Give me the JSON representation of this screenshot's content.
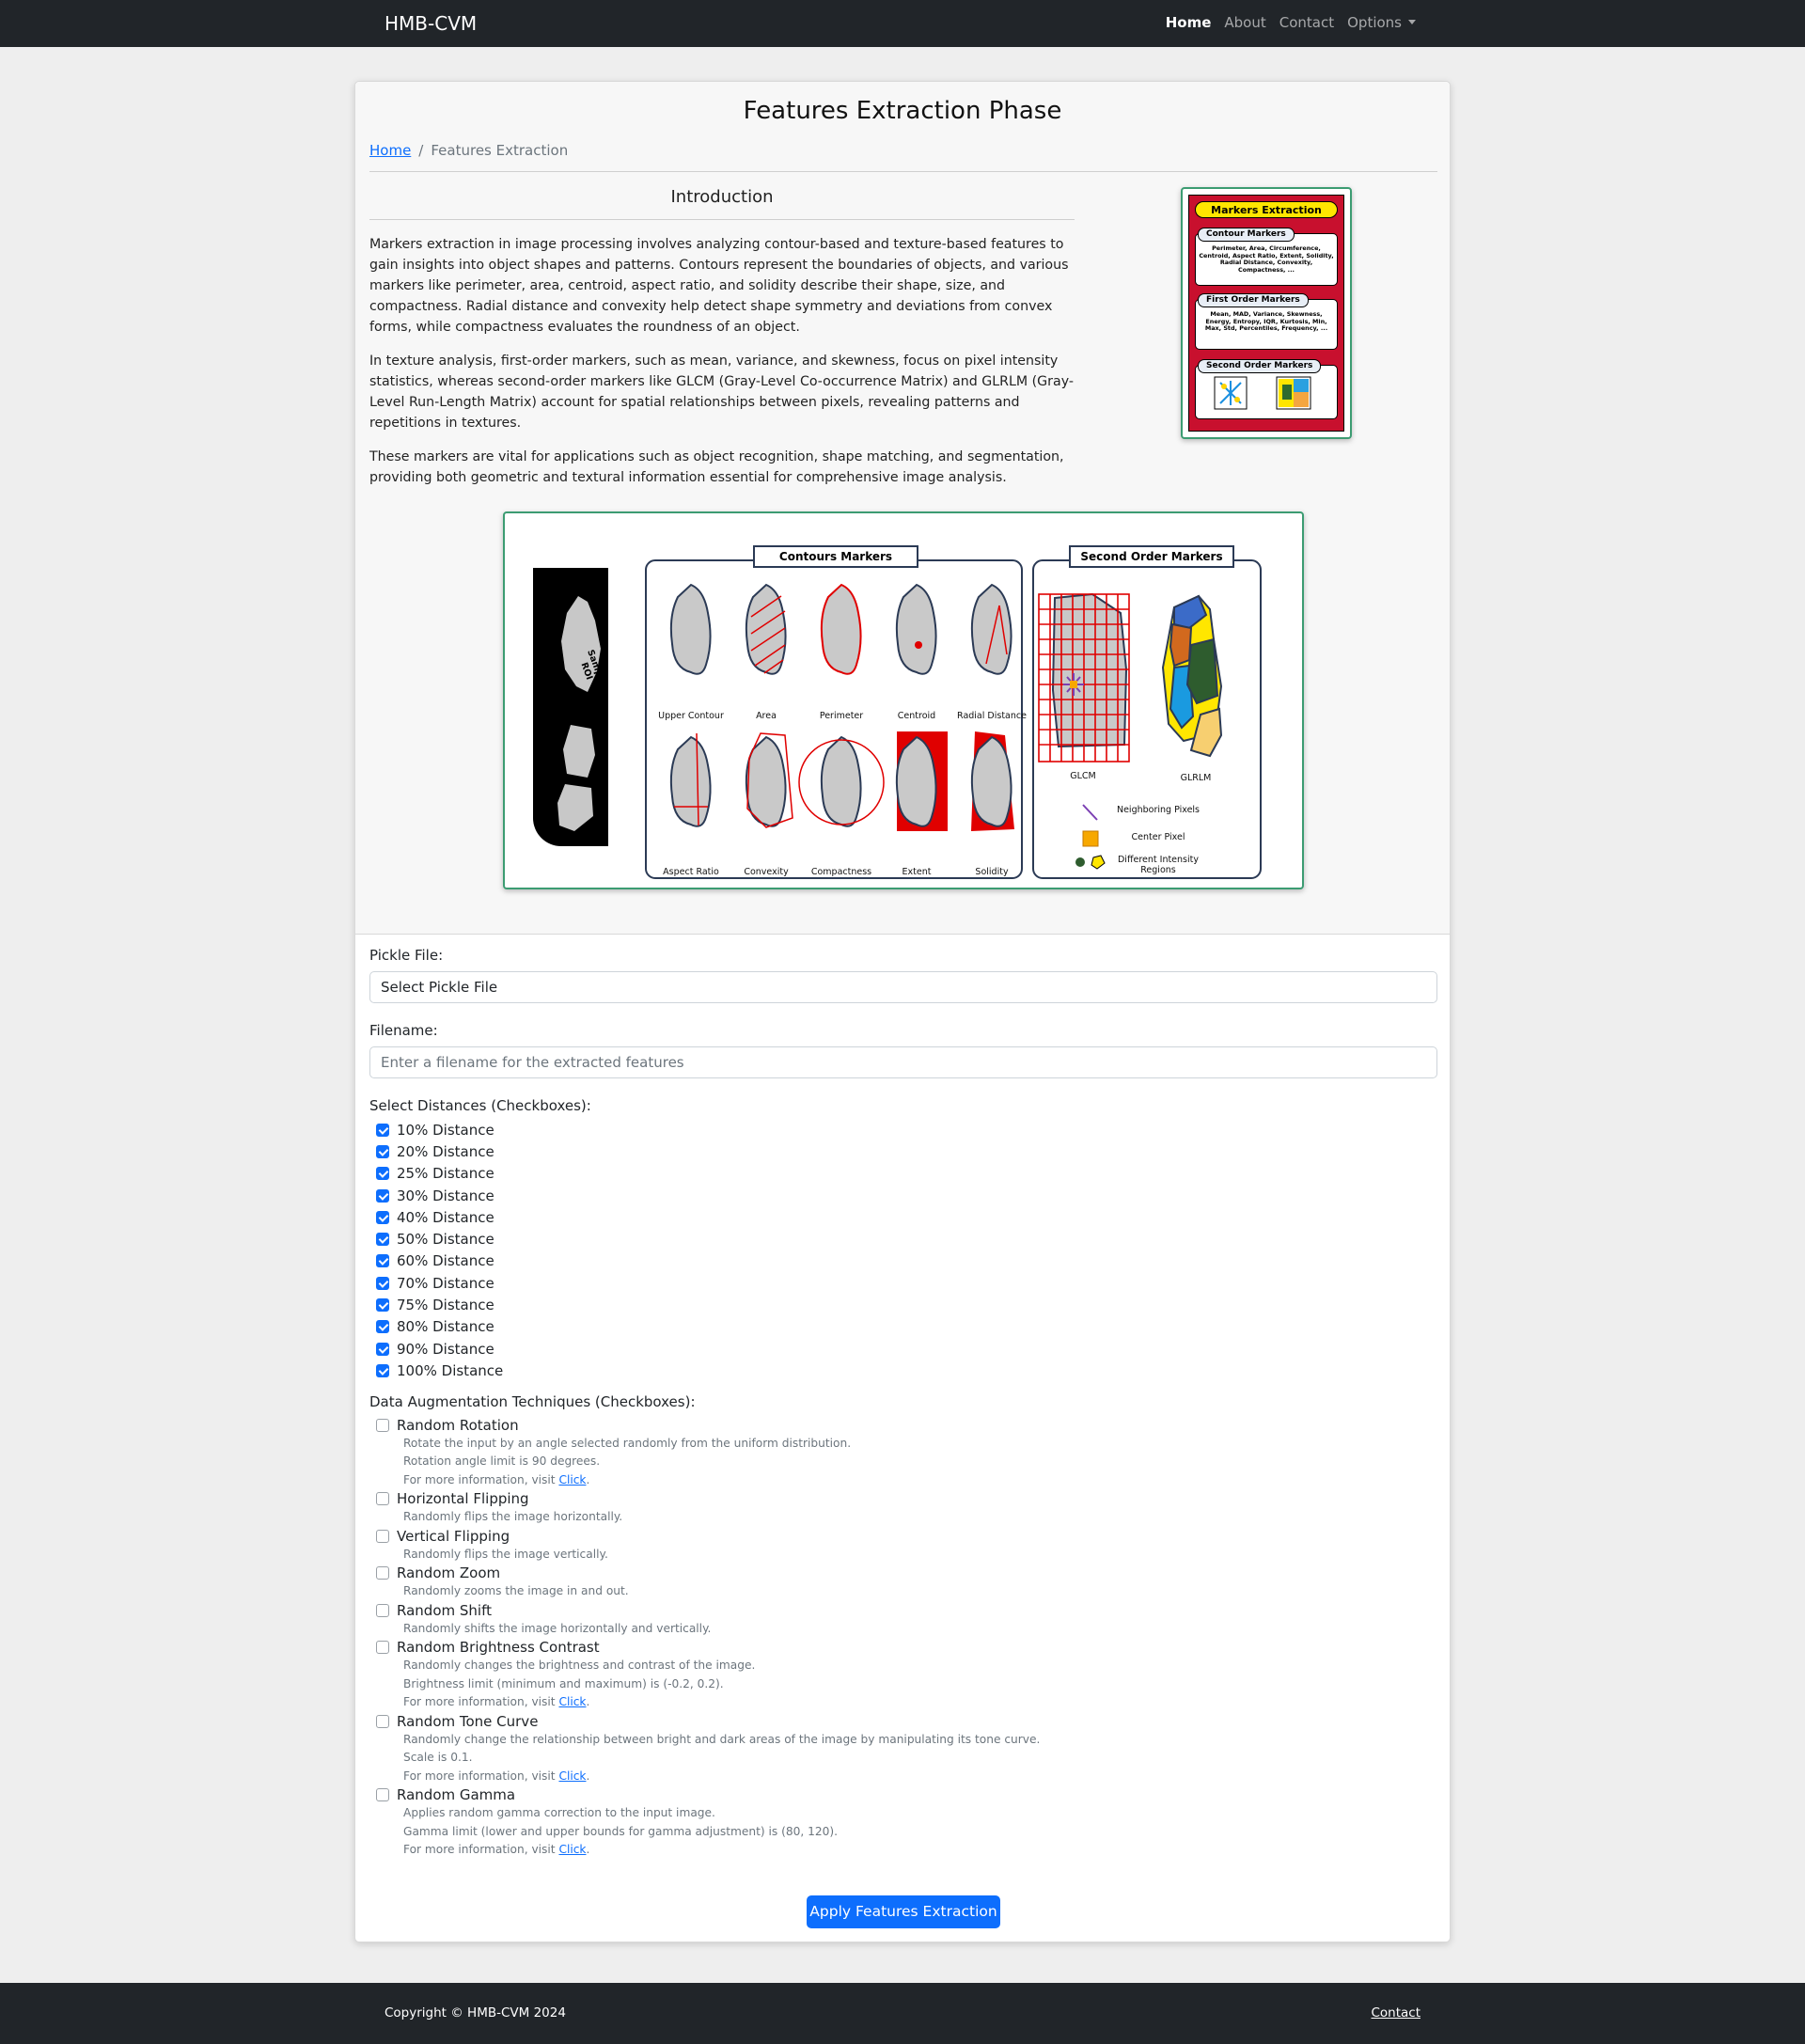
{
  "navbar": {
    "brand": "HMB-CVM",
    "links": [
      "Home",
      "About",
      "Contact",
      "Options"
    ]
  },
  "page": {
    "title": "Features Extraction Phase",
    "breadcrumb": [
      "Home",
      "Features Extraction"
    ]
  },
  "intro": {
    "heading": "Introduction",
    "paragraphs": [
      "Markers extraction in image processing involves analyzing contour-based and texture-based features to gain insights into object shapes and patterns. Contours represent the boundaries of objects, and various markers like perimeter, area, centroid, aspect ratio, and solidity describe their shape, size, and compactness. Radial distance and convexity help detect shape symmetry and deviations from convex forms, while compactness evaluates the roundness of an object.",
      "In texture analysis, first-order markers, such as mean, variance, and skewness, focus on pixel intensity statistics, whereas second-order markers like GLCM (Gray-Level Co-occurrence Matrix) and GLRLM (Gray-Level Run-Length Matrix) account for spatial relationships between pixels, revealing patterns and repetitions in textures.",
      "These markers are vital for applications such as object recognition, shape matching, and segmentation, providing both geometric and textural information essential for comprehensive image analysis."
    ]
  },
  "thumbnail": {
    "title": "Markers Extraction",
    "sections": [
      {
        "label": "Contour Markers",
        "text": "Perimeter, Area, Circumference, Centroid, Aspect Ratio, Extent, Solidity, Radial Distance, Convexity, Compactness, ..."
      },
      {
        "label": "First Order Markers",
        "text": "Mean, MAD, Variance, Skewness, Energy, Entropy, IQR, Kurtosis, Min, Max, Std, Percentiles, Frequency, ..."
      },
      {
        "label": "Second Order Markers",
        "text": "GLCM GLRLM"
      }
    ],
    "colors": {
      "background": "#c8102e",
      "title": "#ffe600"
    }
  },
  "figure": {
    "roi_label": "Sample ROI",
    "contours_header": "Contours Markers",
    "second_header": "Second Order Markers",
    "contour_labels": [
      "Upper Contour",
      "Area",
      "Perimeter",
      "Centroid",
      "Radial Distance",
      "Aspect Ratio",
      "Convexity",
      "Compactness",
      "Extent",
      "Solidity"
    ],
    "texture_labels": [
      "GLCM",
      "GLRLM"
    ],
    "legend": [
      "Neighboring Pixels",
      "Center Pixel",
      "Different Intensity Regions"
    ]
  },
  "form": {
    "pickle_label": "Pickle File:",
    "pickle_value": "Select Pickle File",
    "filename_label": "Filename:",
    "filename_placeholder": "Enter a filename for the extracted features",
    "distances_label": "Select Distances (Checkboxes):",
    "distances": [
      {
        "label": "10% Distance",
        "checked": true
      },
      {
        "label": "20% Distance",
        "checked": true
      },
      {
        "label": "25% Distance",
        "checked": true
      },
      {
        "label": "30% Distance",
        "checked": true
      },
      {
        "label": "40% Distance",
        "checked": true
      },
      {
        "label": "50% Distance",
        "checked": true
      },
      {
        "label": "60% Distance",
        "checked": true
      },
      {
        "label": "70% Distance",
        "checked": true
      },
      {
        "label": "75% Distance",
        "checked": true
      },
      {
        "label": "80% Distance",
        "checked": true
      },
      {
        "label": "90% Distance",
        "checked": true
      },
      {
        "label": "100% Distance",
        "checked": true
      }
    ],
    "augment_label": "Data Augmentation Techniques (Checkboxes):",
    "augmentations": [
      {
        "label": "Random Rotation",
        "checked": false,
        "desc": [
          "Rotate the input by an angle selected randomly from the uniform distribution.",
          "Rotation angle limit is 90 degrees."
        ],
        "link": true
      },
      {
        "label": "Horizontal Flipping",
        "checked": false,
        "desc": [
          "Randomly flips the image horizontally."
        ],
        "link": false
      },
      {
        "label": "Vertical Flipping",
        "checked": false,
        "desc": [
          "Randomly flips the image vertically."
        ],
        "link": false
      },
      {
        "label": "Random Zoom",
        "checked": false,
        "desc": [
          "Randomly zooms the image in and out."
        ],
        "link": false
      },
      {
        "label": "Random Shift",
        "checked": false,
        "desc": [
          "Randomly shifts the image horizontally and vertically."
        ],
        "link": false
      },
      {
        "label": "Random Brightness Contrast",
        "checked": false,
        "desc": [
          "Randomly changes the brightness and contrast of the image.",
          "Brightness limit (minimum and maximum) is (-0.2, 0.2)."
        ],
        "link": true
      },
      {
        "label": "Random Tone Curve",
        "checked": false,
        "desc": [
          "Randomly change the relationship between bright and dark areas of the image by manipulating its tone curve.",
          "Scale is 0.1."
        ],
        "link": true
      },
      {
        "label": "Random Gamma",
        "checked": false,
        "desc": [
          "Applies random gamma correction to the input image.",
          "Gamma limit (lower and upper bounds for gamma adjustment) is (80, 120)."
        ],
        "link": true
      }
    ],
    "more_info_prefix": "For more information, visit ",
    "more_info_link": "Click",
    "submit_label": "Apply Features Extraction"
  },
  "footer": {
    "copyright": "Copyright © HMB-CVM 2024",
    "contact": "Contact"
  },
  "colors": {
    "primary": "#0d6efd",
    "navbar": "#212529",
    "accent_border": "#3c9c72"
  }
}
